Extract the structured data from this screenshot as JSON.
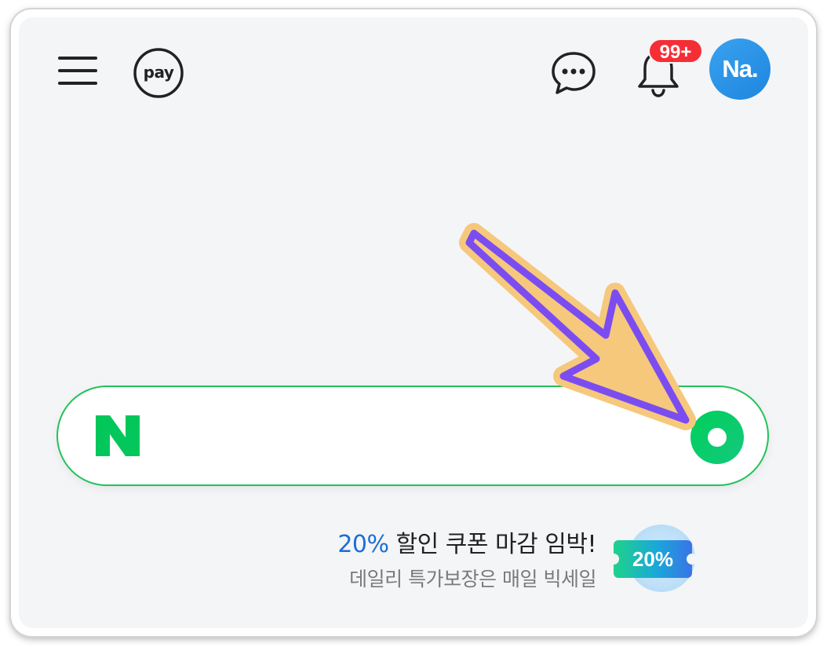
{
  "header": {
    "pay_label": "pay",
    "notification_badge": "99+",
    "avatar_label": "Na."
  },
  "search": {
    "logo_letter": "N",
    "placeholder": ""
  },
  "promo": {
    "title_highlight": "20%",
    "title_rest": " 할인 쿠폰 마감 임박!",
    "subtitle": "데일리 특가보장은 매일 빅세일",
    "coupon_label": "20%"
  },
  "colors": {
    "naver_green": "#03c75a",
    "badge_red": "#f52e36",
    "avatar_blue": "#2a95e8",
    "promo_blue": "#1b6fd6",
    "arrow_purple": "#7b4df0",
    "arrow_fill": "#f6c87c"
  },
  "icons": [
    "menu-icon",
    "pay-icon",
    "chat-icon",
    "bell-icon",
    "search-icon"
  ]
}
